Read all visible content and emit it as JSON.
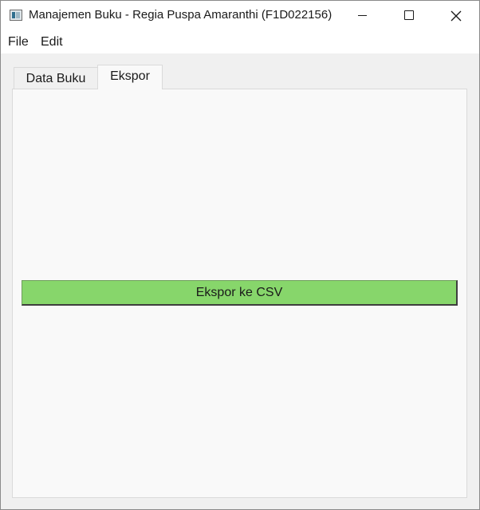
{
  "window": {
    "title": "Manajemen Buku - Regia Puspa Amaranthi (F1D022156)",
    "app_icon": "window-app-icon",
    "controls": {
      "minimize": "minimize-icon",
      "maximize": "maximize-icon",
      "close": "close-icon"
    }
  },
  "menubar": {
    "items": [
      {
        "label": "File"
      },
      {
        "label": "Edit"
      }
    ]
  },
  "tabs": [
    {
      "label": "Data Buku",
      "active": false
    },
    {
      "label": "Ekspor",
      "active": true
    }
  ],
  "ekspor_panel": {
    "export_button_label": "Ekspor ke CSV"
  },
  "colors": {
    "export_button": "#87d66b",
    "panel_background": "#f9f9f9",
    "window_background": "#f0f0f0"
  }
}
